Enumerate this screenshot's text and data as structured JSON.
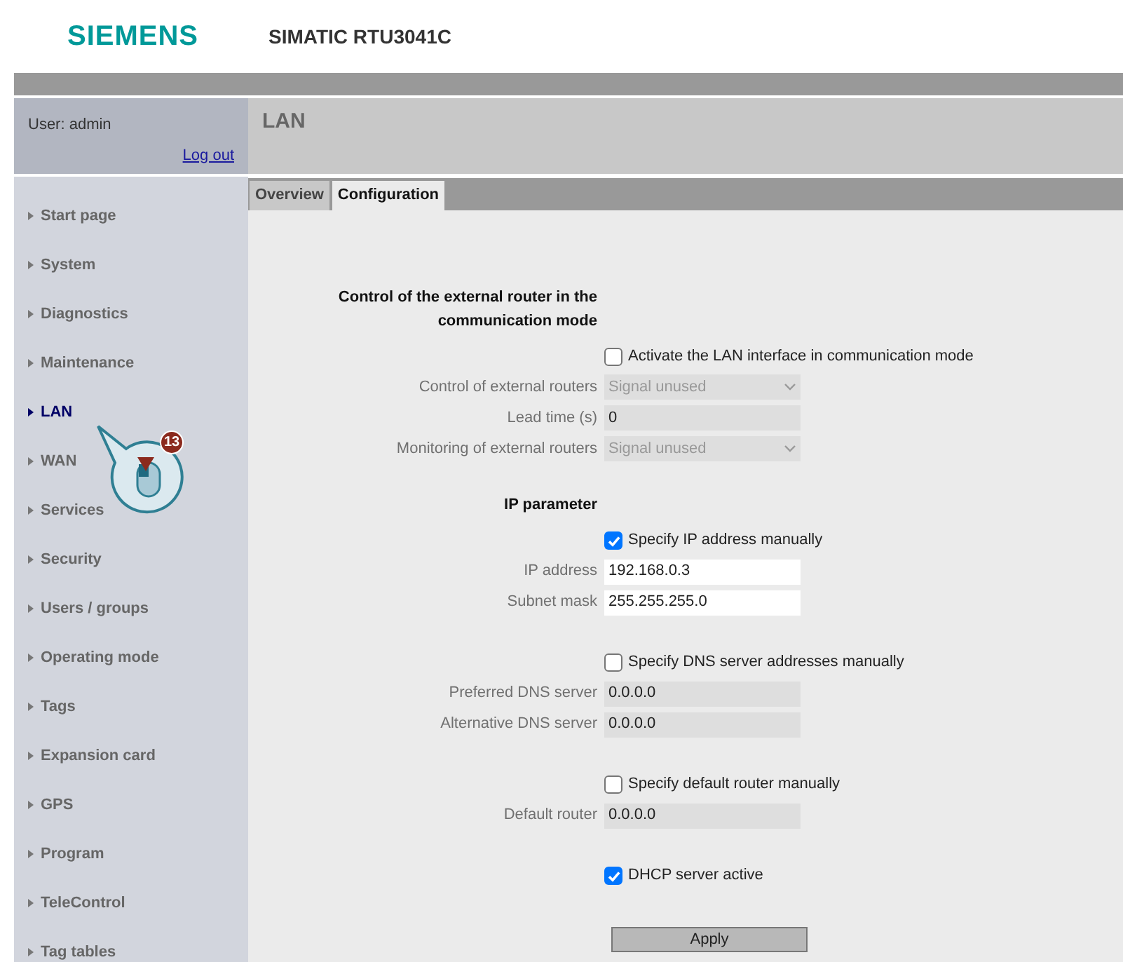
{
  "header": {
    "logo": "SIEMENS",
    "title": "SIMATIC RTU3041C"
  },
  "user": {
    "label": "User: admin",
    "logout": "Log out"
  },
  "sidebar": {
    "items": [
      {
        "label": "Start page",
        "selected": false
      },
      {
        "label": "System",
        "selected": false
      },
      {
        "label": "Diagnostics",
        "selected": false
      },
      {
        "label": "Maintenance",
        "selected": false
      },
      {
        "label": "LAN",
        "selected": true
      },
      {
        "label": "WAN",
        "selected": false
      },
      {
        "label": "Services",
        "selected": false
      },
      {
        "label": "Security",
        "selected": false
      },
      {
        "label": "Users / groups",
        "selected": false
      },
      {
        "label": "Operating mode",
        "selected": false
      },
      {
        "label": "Tags",
        "selected": false
      },
      {
        "label": "Expansion card",
        "selected": false
      },
      {
        "label": "GPS",
        "selected": false
      },
      {
        "label": "Program",
        "selected": false
      },
      {
        "label": "TeleControl",
        "selected": false
      },
      {
        "label": "Tag tables",
        "selected": false
      }
    ]
  },
  "callout": {
    "badge": "13"
  },
  "page_title": "LAN",
  "tabs": [
    {
      "label": "Overview",
      "selected": false
    },
    {
      "label": "Configuration",
      "selected": true
    }
  ],
  "sections": [
    {
      "heading": "Control of the external router in the communication mode",
      "rows": [
        {
          "kind": "checkbox",
          "label": "Activate the LAN interface in communication mode",
          "checked": false
        },
        {
          "kind": "select",
          "label": "Control of external routers",
          "value": "Signal unused",
          "disabled": true
        },
        {
          "kind": "input",
          "label": "Lead time (s)",
          "value": "0",
          "disabled": true
        },
        {
          "kind": "select",
          "label": "Monitoring of external routers",
          "value": "Signal unused",
          "disabled": true
        }
      ]
    },
    {
      "heading": "IP parameter",
      "rows": [
        {
          "kind": "checkbox",
          "label": "Specify IP address manually",
          "checked": true
        },
        {
          "kind": "input",
          "label": "IP address",
          "value": "192.168.0.3",
          "disabled": false
        },
        {
          "kind": "input",
          "label": "Subnet mask",
          "value": "255.255.255.0",
          "disabled": false
        }
      ]
    },
    {
      "rows": [
        {
          "kind": "checkbox",
          "label": "Specify DNS server addresses manually",
          "checked": false
        },
        {
          "kind": "input",
          "label": "Preferred DNS server",
          "value": "0.0.0.0",
          "disabled": true
        },
        {
          "kind": "input",
          "label": "Alternative DNS server",
          "value": "0.0.0.0",
          "disabled": true
        }
      ]
    },
    {
      "rows": [
        {
          "kind": "checkbox",
          "label": "Specify default router manually",
          "checked": false
        },
        {
          "kind": "input",
          "label": "Default router",
          "value": "0.0.0.0",
          "disabled": true
        }
      ]
    },
    {
      "rows": [
        {
          "kind": "checkbox",
          "label": "DHCP server active",
          "checked": true
        }
      ]
    }
  ],
  "apply_button": "Apply"
}
